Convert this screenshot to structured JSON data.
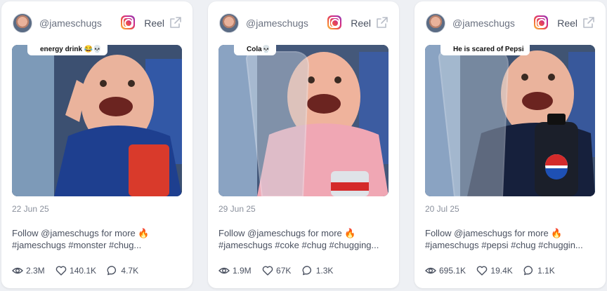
{
  "cards": [
    {
      "handle": "@jameschugs",
      "type_label": "Reel",
      "caption": "energy drink 😂💀",
      "date": "22 Jun 25",
      "desc_line1": "Follow @jameschugs for more 🔥",
      "desc_line2": "#jameschugs #monster #chug...",
      "views": "2.3M",
      "likes": "140.1K",
      "comments": "4.7K",
      "shirt_color": "#1e3f8f",
      "prop_color": "#d93a2b"
    },
    {
      "handle": "@jameschugs",
      "type_label": "Reel",
      "caption": "Cola💀",
      "date": "29 Jun 25",
      "desc_line1": "Follow @jameschugs for more 🔥",
      "desc_line2": "#jameschugs #coke #chug #chugging...",
      "views": "1.9M",
      "likes": "67K",
      "comments": "1.3K",
      "shirt_color": "#f0a7b4",
      "prop_color": "#c9d6e2"
    },
    {
      "handle": "@jameschugs",
      "type_label": "Reel",
      "caption": "He is scared of Pepsi",
      "date": "20 Jul 25",
      "desc_line1": "Follow @jameschugs for more 🔥",
      "desc_line2": "#jameschugs #pepsi #chug #chuggin...",
      "views": "695.1K",
      "likes": "19.4K",
      "comments": "1.1K",
      "shirt_color": "#16203c",
      "prop_color": "#1b1f2a"
    }
  ],
  "icons": {
    "platform": "instagram-icon",
    "open": "external-link-icon",
    "views": "eye-icon",
    "likes": "heart-icon",
    "comments": "comment-icon"
  }
}
